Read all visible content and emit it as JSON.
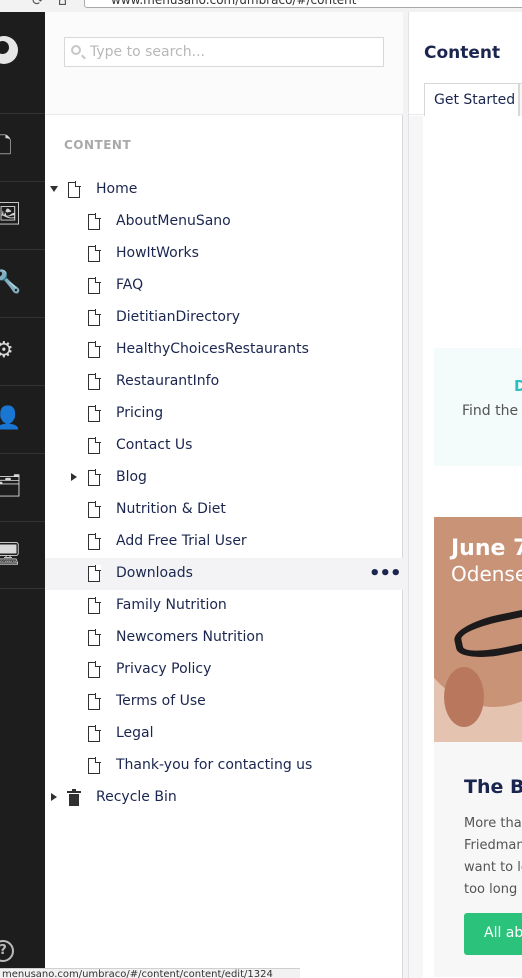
{
  "browser": {
    "url": "www.menusano.com/umbraco/#/content"
  },
  "appnav": {
    "sections": [
      {
        "name": "content-section-icon",
        "glyph": "🗋"
      },
      {
        "name": "media-section-icon",
        "glyph": "🖼"
      },
      {
        "name": "settings-section-icon",
        "glyph": "🔧"
      },
      {
        "name": "developer-section-icon",
        "glyph": "⚙"
      },
      {
        "name": "users-section-icon",
        "glyph": "👤"
      },
      {
        "name": "members-section-icon",
        "glyph": "🗂"
      },
      {
        "name": "forms-section-icon",
        "glyph": "🖥"
      }
    ],
    "help_label": "?"
  },
  "tree": {
    "search_placeholder": "Type to search...",
    "heading": "CONTENT",
    "root": "Home",
    "items": [
      "AboutMenuSano",
      "HowItWorks",
      "FAQ",
      "DietitianDirectory",
      "HealthyChoicesRestaurants",
      "RestaurantInfo",
      "Pricing",
      "Contact Us",
      "Blog",
      "Nutrition & Diet",
      "Add Free Trial User",
      "Downloads",
      "Family Nutrition",
      "Newcomers Nutrition",
      "Privacy Policy",
      "Terms of Use",
      "Legal",
      "Thank-you for contacting us"
    ],
    "recycle_bin": "Recycle Bin",
    "actions_label": "•••"
  },
  "content": {
    "title": "Content",
    "tab_label": "Get Started",
    "callout_title": "D",
    "callout_text": "Find the a",
    "card_photo_line1": "June 7",
    "card_photo_line2": "Odense",
    "card_title": "The Big",
    "card_text": [
      "More thar",
      "Friedman",
      "want to le",
      "too long i"
    ],
    "card_button": "All abo"
  },
  "status": {
    "text": "menusano.com/umbraco/#/content/content/edit/1324"
  }
}
